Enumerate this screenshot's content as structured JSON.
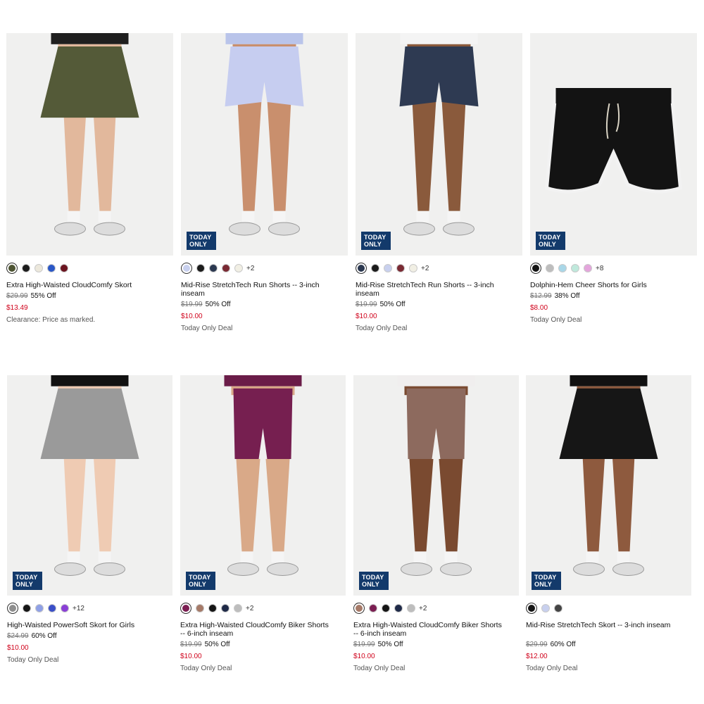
{
  "badge": {
    "line1": "TODAY",
    "line2": "ONLY"
  },
  "products": [
    {
      "title": "Extra High-Waisted CloudComfy Skort",
      "original_price": "$29.99",
      "discount": "55% Off",
      "sale_price": "$13.49",
      "note": "Clearance: Price as marked.",
      "today_only": false,
      "more_colors": "",
      "swatches": [
        "#4d5432",
        "#1c1c1c",
        "#ece8dc",
        "#2a57c7",
        "#6b1420"
      ],
      "art": {
        "type": "skort",
        "top": "#1f1f1f",
        "color": "#545a38",
        "skin": "#e2b89c"
      }
    },
    {
      "title": "Mid-Rise StretchTech Run Shorts -- 3-inch inseam",
      "original_price": "$19.99",
      "discount": "50% Off",
      "sale_price": "$10.00",
      "note": "Today Only Deal",
      "today_only": true,
      "more_colors": "+2",
      "swatches": [
        "#c8d0ee",
        "#1b1b1b",
        "#2b3850",
        "#7a2a33",
        "#f1efe4"
      ],
      "art": {
        "type": "shorts",
        "top": "#b9c4ea",
        "color": "#c6cdf0",
        "skin": "#c98f6d"
      }
    },
    {
      "title": "Mid-Rise StretchTech Run Shorts -- 3-inch inseam",
      "original_price": "$19.99",
      "discount": "50% Off",
      "sale_price": "$10.00",
      "note": "Today Only Deal",
      "today_only": true,
      "more_colors": "+2",
      "swatches": [
        "#2b3850",
        "#1b1b1b",
        "#c8d0ee",
        "#7a2a33",
        "#f1efe4"
      ],
      "art": {
        "type": "shorts",
        "top": "#f4f4f4",
        "color": "#2e3a52",
        "skin": "#8a5a3c"
      }
    },
    {
      "title": "Dolphin-Hem Cheer Shorts for Girls",
      "original_price": "$12.99",
      "discount": "38% Off",
      "sale_price": "$8.00",
      "note": "Today Only Deal",
      "today_only": true,
      "more_colors": "+8",
      "swatches": [
        "#151515",
        "#bdbdbd",
        "#a9d7e8",
        "#bfe9dc",
        "#e4a5dc"
      ],
      "art": {
        "type": "flat",
        "top": "",
        "color": "#131313",
        "skin": ""
      }
    },
    {
      "title": "High-Waisted PowerSoft Skort for Girls",
      "original_price": "$24.99",
      "discount": "60% Off",
      "sale_price": "$10.00",
      "note": "Today Only Deal",
      "today_only": true,
      "more_colors": "+12",
      "swatches": [
        "#8e8e8e",
        "#151515",
        "#8fa0e6",
        "#3a4fc8",
        "#8a3fd6"
      ],
      "art": {
        "type": "skort",
        "top": "#111111",
        "color": "#9a9a9a",
        "skin": "#efcbb3"
      }
    },
    {
      "title": "Extra High-Waisted CloudComfy Biker Shorts -- 6-inch inseam",
      "original_price": "$19.99",
      "discount": "50% Off",
      "sale_price": "$10.00",
      "note": "Today Only Deal",
      "today_only": true,
      "more_colors": "+2",
      "swatches": [
        "#7b1e52",
        "#a67a68",
        "#151515",
        "#1f2a48",
        "#bdbdbd"
      ],
      "art": {
        "type": "biker",
        "top": "#6a1c48",
        "color": "#761f50",
        "skin": "#d9a988"
      }
    },
    {
      "title": "Extra High-Waisted CloudComfy Biker Shorts -- 6-inch inseam",
      "original_price": "$19.99",
      "discount": "50% Off",
      "sale_price": "$10.00",
      "note": "Today Only Deal",
      "today_only": true,
      "more_colors": "+2",
      "swatches": [
        "#a67a68",
        "#7b1e52",
        "#151515",
        "#1f2a48",
        "#bdbdbd"
      ],
      "art": {
        "type": "biker",
        "top": "#f0eeee",
        "color": "#8d6a5e",
        "skin": "#7a4a30"
      }
    },
    {
      "title": "Mid-Rise StretchTech Skort -- 3-inch inseam",
      "original_price": "$29.99",
      "discount": "60% Off",
      "sale_price": "$12.00",
      "note": "Today Only Deal",
      "today_only": true,
      "more_colors": "",
      "swatches": [
        "#151515",
        "#c8d0ee",
        "#444444"
      ],
      "art": {
        "type": "skort",
        "top": "#111111",
        "color": "#161616",
        "skin": "#8e5a3e"
      }
    }
  ]
}
